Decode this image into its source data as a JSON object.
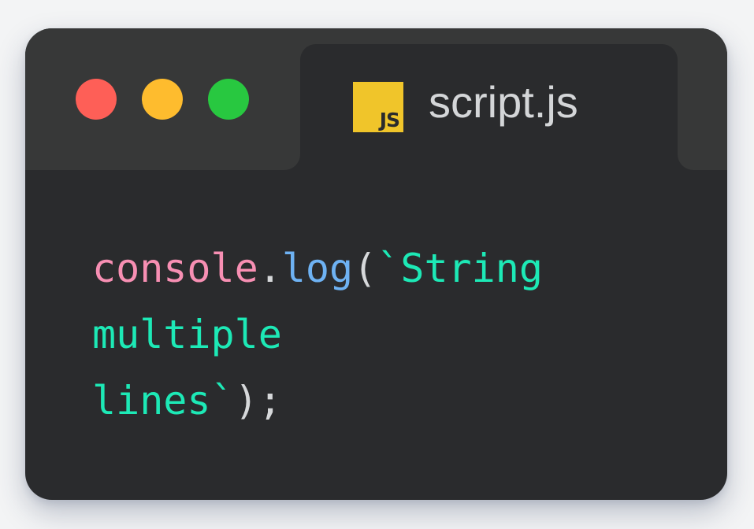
{
  "window": {
    "controls": [
      {
        "name": "close",
        "color": "#fe5f57"
      },
      {
        "name": "minimize",
        "color": "#febc2e"
      },
      {
        "name": "maximize",
        "color": "#28c840"
      }
    ]
  },
  "tab": {
    "icon_text": "JS",
    "icon_color": "#f0c52a",
    "title": "script.js"
  },
  "code": {
    "colors": {
      "identifier": "#f78fb3",
      "punctuation": "#d6d8da",
      "method": "#6eb2f3",
      "string": "#1de9b6"
    },
    "lines": [
      {
        "tokens": [
          {
            "text": "console",
            "kind": "identifier"
          },
          {
            "text": ".",
            "kind": "punctuation"
          },
          {
            "text": "log",
            "kind": "method"
          },
          {
            "text": "(",
            "kind": "punctuation"
          },
          {
            "text": "`String",
            "kind": "string"
          }
        ]
      },
      {
        "tokens": [
          {
            "text": "multiple",
            "kind": "string"
          }
        ]
      },
      {
        "tokens": [
          {
            "text": "lines`",
            "kind": "string"
          },
          {
            "text": ");",
            "kind": "punctuation"
          }
        ]
      }
    ]
  }
}
